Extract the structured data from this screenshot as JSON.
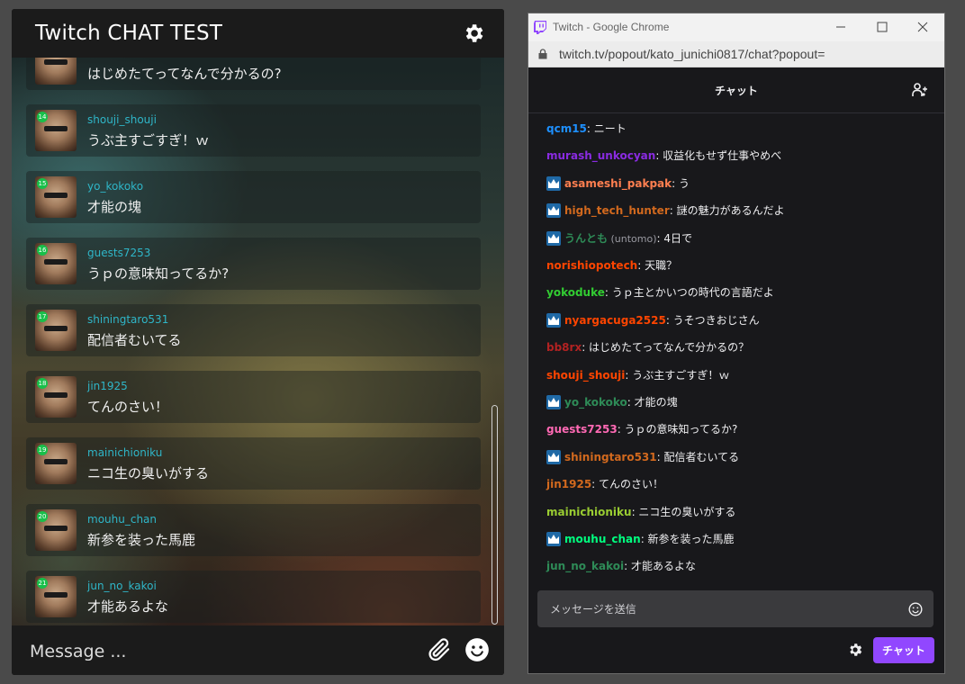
{
  "app": {
    "title": "Twitch CHAT TEST",
    "message_placeholder": "Message ...",
    "messages": [
      {
        "badge": "",
        "user": "",
        "text": "はじめたてってなんで分かるの?"
      },
      {
        "badge": "14",
        "user": "shouji_shouji",
        "text": "うぶ主すごすぎ！ｗ"
      },
      {
        "badge": "15",
        "user": "yo_kokoko",
        "text": "才能の塊"
      },
      {
        "badge": "16",
        "user": "guests7253",
        "text": "うｐの意味知ってるか?"
      },
      {
        "badge": "17",
        "user": "shiningtaro531",
        "text": "配信者むいてる"
      },
      {
        "badge": "18",
        "user": "jin1925",
        "text": "てんのさい！"
      },
      {
        "badge": "19",
        "user": "mainichioniku",
        "text": "ニコ生の臭いがする"
      },
      {
        "badge": "20",
        "user": "mouhu_chan",
        "text": "新参を装った馬鹿"
      },
      {
        "badge": "21",
        "user": "jun_no_kakoi",
        "text": "才能あるよな"
      }
    ]
  },
  "chrome": {
    "title": "Twitch - Google Chrome",
    "url": "twitch.tv/popout/kato_junichi0817/chat?popout=",
    "header_title": "チャット",
    "input_placeholder": "メッセージを送信",
    "send_label": "チャット",
    "lines": [
      {
        "crown": false,
        "user": "qcm15",
        "alt": "",
        "text": ": ニート",
        "color": "#1e90ff"
      },
      {
        "crown": false,
        "user": "murash_unkocyan",
        "alt": "",
        "text": ": 収益化もせず仕事やめべ",
        "color": "#8a2be2"
      },
      {
        "crown": true,
        "user": "asameshi_pakpak",
        "alt": "",
        "text": ": う",
        "color": "#ff7f50"
      },
      {
        "crown": true,
        "user": "high_tech_hunter",
        "alt": "",
        "text": ": 謎の魅力があるんだよ",
        "color": "#d2691e"
      },
      {
        "crown": true,
        "user": "うんとも",
        "alt": " (untomo)",
        "text": ": 4日で",
        "color": "#2e8b57"
      },
      {
        "crown": false,
        "user": "norishiopotech",
        "alt": "",
        "text": ": 天職？",
        "color": "#ff4500"
      },
      {
        "crown": false,
        "user": "yokoduke",
        "alt": "",
        "text": ": うｐ主とかいつの時代の言語だよ",
        "color": "#32cd32"
      },
      {
        "crown": true,
        "user": "nyargacuga2525",
        "alt": "",
        "text": ": うそつきおじさん",
        "color": "#ff4500"
      },
      {
        "crown": false,
        "user": "bb8rx",
        "alt": "",
        "text": ": はじめたてってなんで分かるの？",
        "color": "#b22222"
      },
      {
        "crown": false,
        "user": "shouji_shouji",
        "alt": "",
        "text": ": うぶ主すごすぎ！ｗ",
        "color": "#ff4500"
      },
      {
        "crown": true,
        "user": "yo_kokoko",
        "alt": "",
        "text": ": 才能の塊",
        "color": "#2e8b57"
      },
      {
        "crown": false,
        "user": "guests7253",
        "alt": "",
        "text": ": うｐの意味知ってるか?",
        "color": "#ff69b4"
      },
      {
        "crown": true,
        "user": "shiningtaro531",
        "alt": "",
        "text": ": 配信者むいてる",
        "color": "#d2691e"
      },
      {
        "crown": false,
        "user": "jin1925",
        "alt": "",
        "text": ": てんのさい！",
        "color": "#d2691e"
      },
      {
        "crown": false,
        "user": "mainichioniku",
        "alt": "",
        "text": ": ニコ生の臭いがする",
        "color": "#9acd32"
      },
      {
        "crown": true,
        "user": "mouhu_chan",
        "alt": "",
        "text": ": 新参を装った馬鹿",
        "color": "#00ff7f"
      },
      {
        "crown": false,
        "user": "jun_no_kakoi",
        "alt": "",
        "text": ": 才能あるよな",
        "color": "#2e8b57"
      }
    ]
  }
}
